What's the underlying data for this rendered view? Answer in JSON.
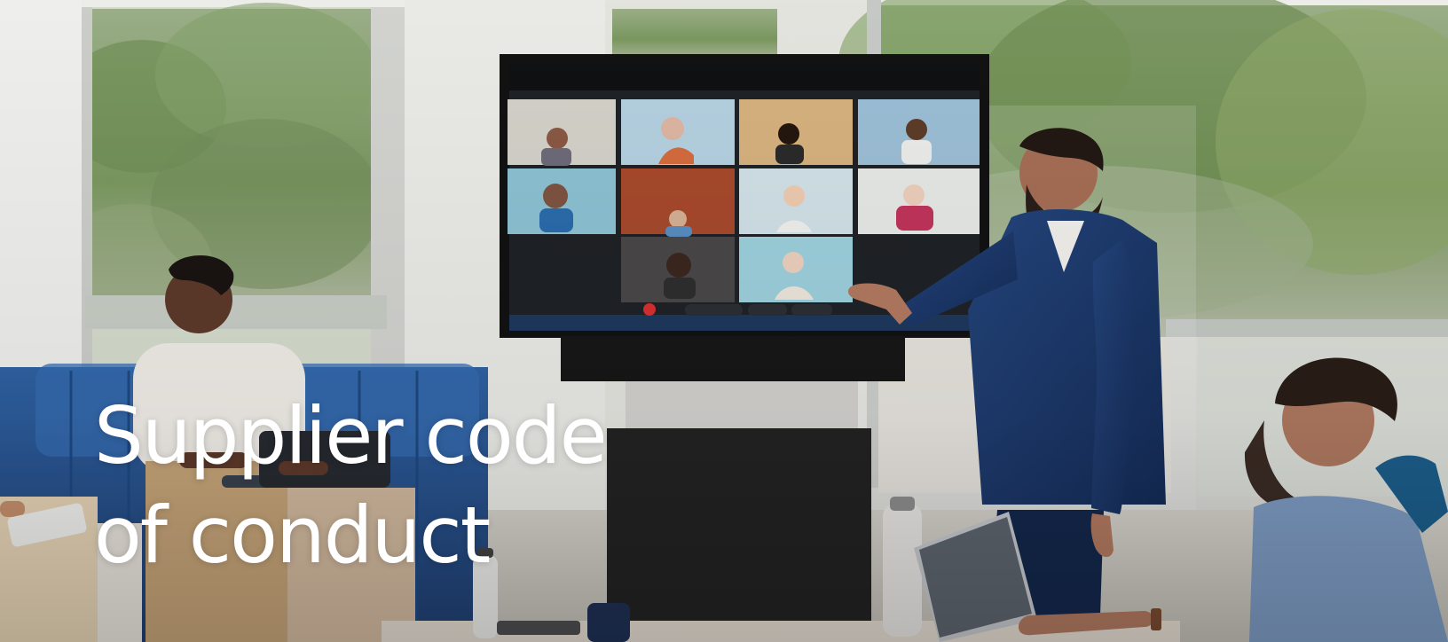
{
  "hero": {
    "title_line_1": "Supplier code",
    "title_line_2": "of conduct"
  }
}
